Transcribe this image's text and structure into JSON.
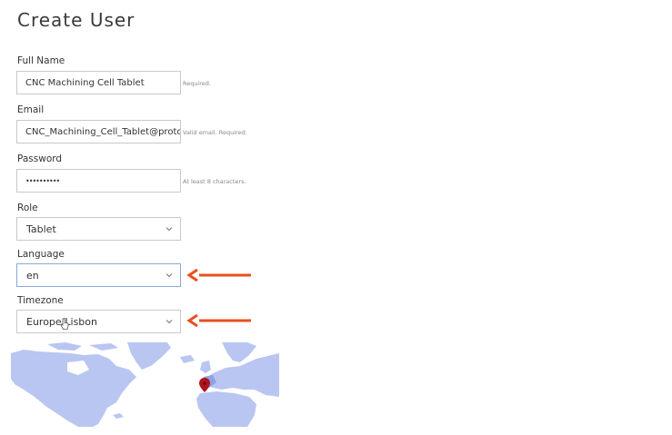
{
  "page": {
    "title": "Create User"
  },
  "form": {
    "full_name": {
      "label": "Full Name",
      "value": "CNC Machining Cell Tablet",
      "hint": "Required."
    },
    "email": {
      "label": "Email",
      "value": "CNC_Machining_Cell_Tablet@protonr",
      "hint": "Valid email. Required."
    },
    "password": {
      "label": "Password",
      "value": "••••••••••",
      "hint": "At least 8 characters."
    },
    "role": {
      "label": "Role",
      "selected": "Tablet"
    },
    "language": {
      "label": "Language",
      "selected": "en"
    },
    "timezone": {
      "label": "Timezone",
      "selected": "Europe/Lisbon"
    }
  },
  "icons": {
    "select_chevron": "chevron-down-icon",
    "annotation_arrow": "arrow-left-icon",
    "map_pin": "map-pin-icon",
    "cursor": "hand-pointer-icon"
  },
  "colors": {
    "arrow": "#e8501e",
    "map_land": "#b9c6f2",
    "map_sea": "#ffffff",
    "pin": "#b0141e",
    "focus_border": "#8aa9d6"
  }
}
